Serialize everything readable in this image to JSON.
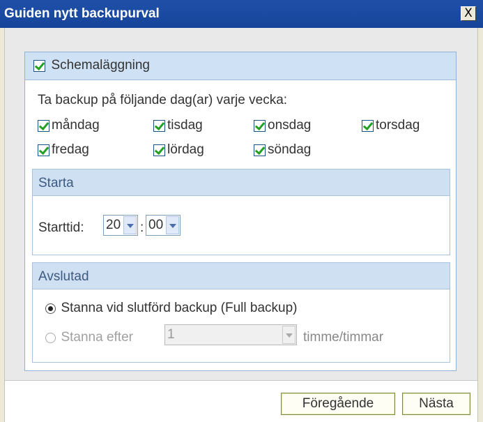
{
  "window": {
    "title": "Guiden nytt backupurval",
    "close_label": "X"
  },
  "scheduling": {
    "label": "Schemaläggning",
    "checked": true,
    "description": "Ta backup på följande dag(ar) varje vecka:",
    "days": [
      {
        "label": "måndag",
        "checked": true
      },
      {
        "label": "tisdag",
        "checked": true
      },
      {
        "label": "onsdag",
        "checked": true
      },
      {
        "label": "torsdag",
        "checked": true
      },
      {
        "label": "fredag",
        "checked": true
      },
      {
        "label": "lördag",
        "checked": true
      },
      {
        "label": "söndag",
        "checked": true
      }
    ]
  },
  "start": {
    "header": "Starta",
    "time_label": "Starttid:",
    "hour": "20",
    "separator": ":",
    "minute": "00"
  },
  "end": {
    "header": "Avslutad",
    "option_full": "Stanna vid slutförd backup (Full backup)",
    "option_after": "Stanna efter",
    "after_value": "1",
    "after_unit": "timme/timmar",
    "selected": "full"
  },
  "buttons": {
    "previous": "Föregående",
    "next": "Nästa"
  },
  "colors": {
    "titlebar": "#1f50a8",
    "panel_header": "#cfe1f5",
    "check": "#21a121",
    "button_border": "#7a8a3a"
  }
}
